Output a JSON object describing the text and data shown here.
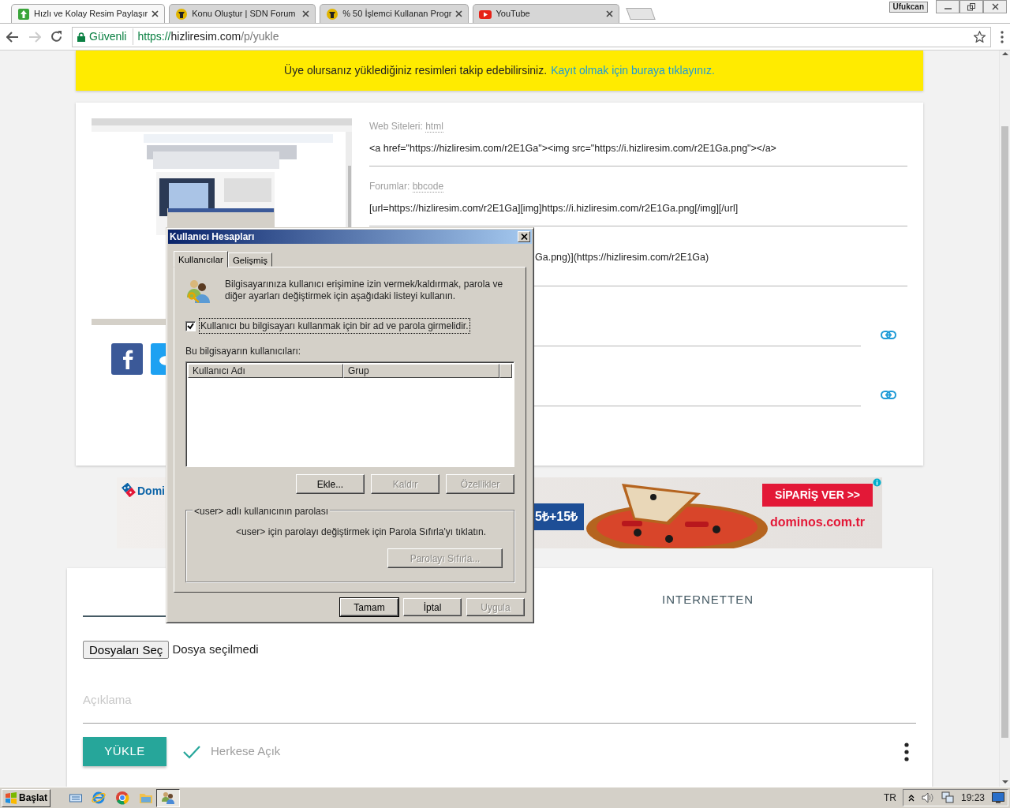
{
  "browser": {
    "tabs": [
      {
        "title": "Hızlı ve Kolay Resim Paylaşır",
        "selected": true
      },
      {
        "title": "Konu Oluştur | SDN Forum",
        "selected": false
      },
      {
        "title": "% 50 İşlemci Kullanan Progr",
        "selected": false
      },
      {
        "title": "YouTube",
        "selected": false
      }
    ],
    "profile": "Ufukcan",
    "security": "Güvenli",
    "url": {
      "scheme": "https://",
      "host": "hizliresim.com",
      "path": "/p/yukle"
    }
  },
  "notice": {
    "text": "Üye olursanız yüklediğiniz resimleri takip edebilirsiniz.",
    "link": "Kayıt olmak için buraya tıklayınız."
  },
  "share_fields": [
    {
      "kind": "code",
      "label": "Web Siteleri:",
      "format": "html",
      "value": "<a href=\"https://hizliresim.com/r2E1Ga\"><img src=\"https://i.hizliresim.com/r2E1Ga.png\"></a>"
    },
    {
      "kind": "code",
      "label": "Forumlar:",
      "format": "bbcode",
      "value": "[url=https://hizliresim.com/r2E1Ga][img]https://i.hizliresim.com/r2E1Ga.png[/img][/url]"
    },
    {
      "kind": "code",
      "value": "Ga.png)](https://hizliresim.com/r2E1Ga)"
    },
    {
      "kind": "link"
    },
    {
      "kind": "link"
    }
  ],
  "ad": {
    "brand": "Domi",
    "price": "5₺+15₺",
    "cta": "SİPARİŞ VER >>",
    "site": "dominos.com.tr"
  },
  "upload": {
    "tabs": [
      {
        "selected": true
      },
      {
        "label": "INTERNETTEN",
        "selected": false
      }
    ],
    "file_button": "Dosyaları Seç",
    "file_status": "Dosya seçilmedi",
    "description": {
      "placeholder": "Açıklama"
    },
    "submit": "YÜKLE",
    "visibility": {
      "label": "Herkese Açık",
      "checked": true
    }
  },
  "dialog": {
    "title": "Kullanıcı Hesapları",
    "tabs": [
      {
        "label": "Kullanıcılar",
        "selected": true
      },
      {
        "label": "Gelişmiş",
        "selected": false
      }
    ],
    "intro": "Bilgisayarınıza kullanıcı erişimine izin vermek/kaldırmak, parola ve diğer ayarları değiştirmek için aşağıdaki listeyi kullanın.",
    "require_password": {
      "label": "Kullanıcı bu bilgisayarı kullanmak için bir ad ve parola girmelidir.",
      "checked": true
    },
    "list_label": "Bu bilgisayarın kullanıcıları:",
    "columns": [
      "Kullanıcı Adı",
      "Grup"
    ],
    "list_buttons": [
      {
        "label": "Ekle...",
        "disabled": false
      },
      {
        "label": "Kaldır",
        "disabled": true
      },
      {
        "label": "Özellikler",
        "disabled": true
      }
    ],
    "password_group": {
      "title": "<user> adlı kullanıcının parolası",
      "text": "<user> için parolayı değiştirmek için Parola Sıfırla'yı tıklatın.",
      "button": {
        "label": "Parolayı Sıfırla...",
        "disabled": true
      }
    },
    "buttons": [
      {
        "label": "Tamam",
        "disabled": false,
        "default": true
      },
      {
        "label": "İptal",
        "disabled": false,
        "default": false
      },
      {
        "label": "Uygula",
        "disabled": true,
        "default": false
      }
    ]
  },
  "taskbar": {
    "start": "Başlat",
    "language": "TR",
    "clock": "19:23"
  }
}
